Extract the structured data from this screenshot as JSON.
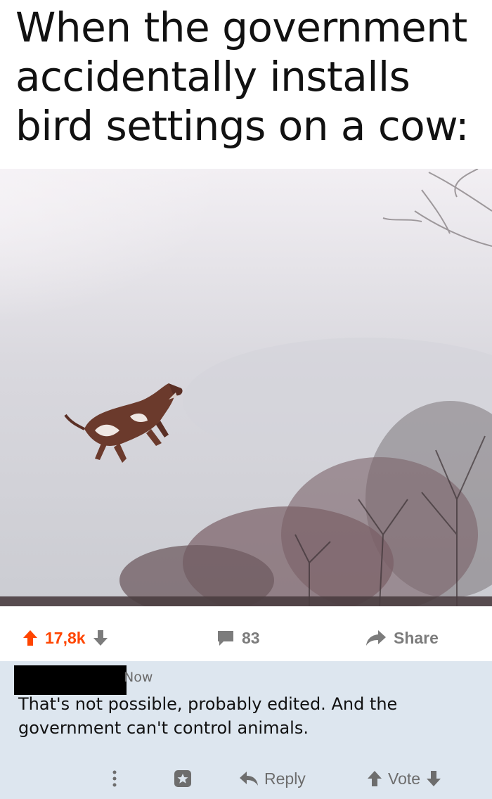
{
  "meme": {
    "caption": "When the government accidentally installs bird settings on a cow:"
  },
  "post_actions": {
    "score": "17,8k",
    "comment_count": "83",
    "share_label": "Share"
  },
  "comment": {
    "time": "Now",
    "text": "That's not possible, probably edited. And the government can't control animals.",
    "reply_label": "Reply",
    "vote_label": "Vote"
  },
  "colors": {
    "upvote": "#ff4500",
    "muted": "#7c7c7c",
    "comment_bg": "#dde6ef"
  },
  "icons": [
    "upvote-arrow-icon",
    "downvote-arrow-icon",
    "comment-bubble-icon",
    "share-arrow-icon",
    "more-options-icon",
    "award-icon",
    "reply-arrow-icon"
  ]
}
